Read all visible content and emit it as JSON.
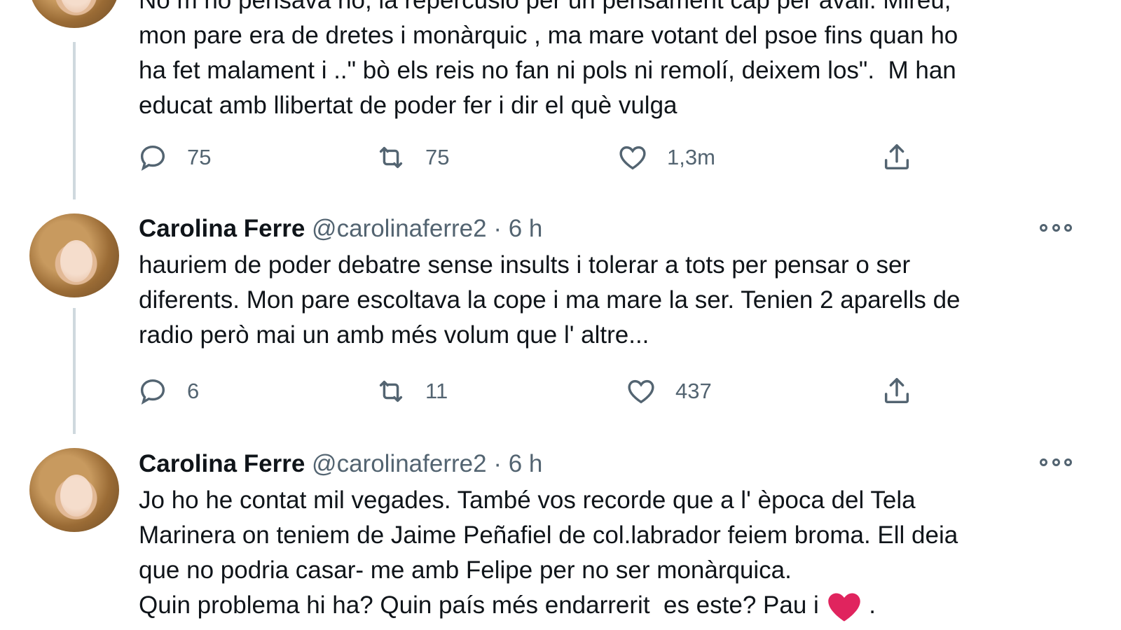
{
  "tweets": [
    {
      "text": "No m no pensava no, la repercusió per un pensament cap per avall. Mireu,\nmon pare era de dretes i monàrquic , ma mare votant del psoe fins quan ho\nha fet malament i ..\" bò els reis no fan ni pols ni remolí, deixem los\".  M han\neducat amb llibertat de poder fer i dir el què vulga",
      "actions": {
        "replies": "75",
        "retweets": "75",
        "likes": "1,3m"
      }
    },
    {
      "name": "Carolina Ferre",
      "handle": "@carolinaferre2",
      "dot": "·",
      "time": "6 h",
      "text": "hauriem de poder debatre sense insults i tolerar a tots per pensar o ser\ndiferents. Mon pare escoltava la cope i ma mare la ser. Tenien 2 aparells de\nradio però mai un amb més volum que l' altre...",
      "actions": {
        "replies": "6",
        "retweets": "11",
        "likes": "437"
      }
    },
    {
      "name": "Carolina Ferre",
      "handle": "@carolinaferre2",
      "dot": "·",
      "time": "6 h",
      "text": "Jo ho he contat mil vegades. També vos recorde que a l' època del Tela\nMarinera on teniem de Jaime Peñafiel de col.labrador feiem broma. Ell deia\nque no podria casar- me amb Felipe per no ser monàrquica.",
      "last_line_before_emoji": "Quin problema hi ha? Quin país més endarrerit  es este? Pau i ",
      "last_line_after_emoji": " ."
    }
  ],
  "colors": {
    "text": "#0f1419",
    "secondary": "#536471",
    "thread": "#cfd9de",
    "heart_emoji": "#e0245e"
  },
  "icons": [
    "reply-icon",
    "retweet-icon",
    "like-icon",
    "share-icon",
    "more-icon",
    "heart-emoji"
  ]
}
